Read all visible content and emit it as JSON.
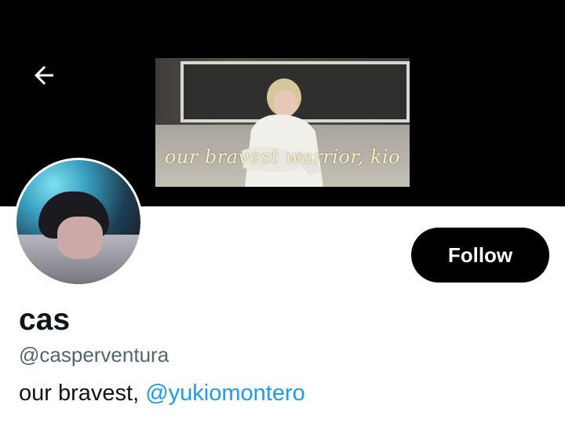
{
  "header": {
    "back_icon": "arrow-left-icon",
    "banner_caption": "our bravest warrior, kio"
  },
  "profile": {
    "display_name": "cas",
    "handle": "@casperventura",
    "bio_text": "our bravest,",
    "bio_mention": "@yukiomontero",
    "follow_label": "Follow"
  },
  "colors": {
    "banner_bg": "#000000",
    "follow_bg": "#000000",
    "follow_text": "#ffffff",
    "handle_text": "#536471",
    "mention_link": "#1d9bf0"
  }
}
